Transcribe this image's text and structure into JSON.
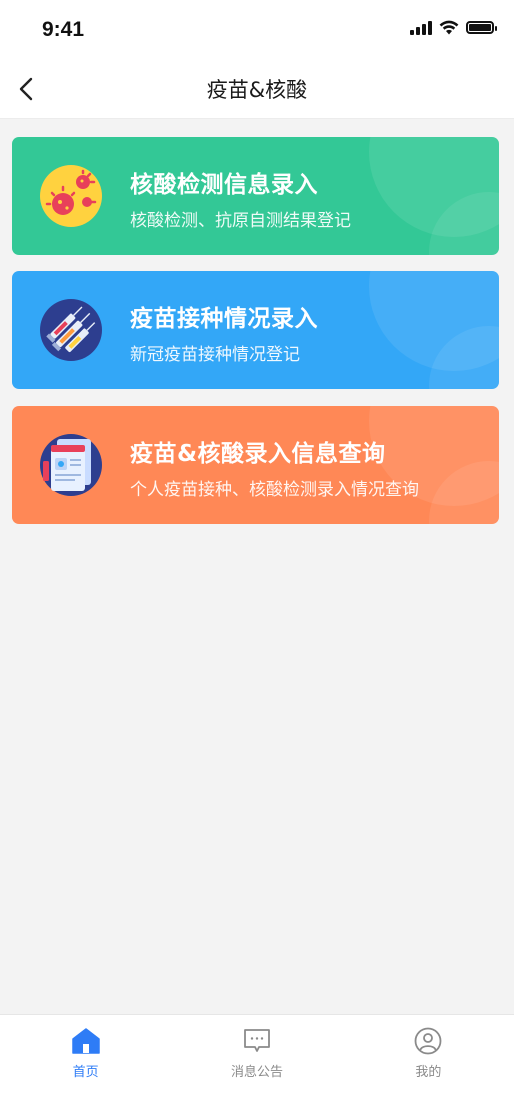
{
  "status_bar": {
    "time": "9:41"
  },
  "nav": {
    "title": "疫苗&核酸"
  },
  "cards": [
    {
      "title": "核酸检测信息录入",
      "subtitle": "核酸检测、抗原自测结果登记",
      "icon": "virus-icon",
      "color": "#33c896"
    },
    {
      "title": "疫苗接种情况录入",
      "subtitle": "新冠疫苗接种情况登记",
      "icon": "syringe-icon",
      "color": "#33a7f7"
    },
    {
      "title": "疫苗&核酸录入信息查询",
      "subtitle": "个人疫苗接种、核酸检测录入情况查询",
      "icon": "document-icon",
      "color": "#ff8856"
    }
  ],
  "tabbar": {
    "items": [
      {
        "label": "首页",
        "icon": "home-icon",
        "active": true
      },
      {
        "label": "消息公告",
        "icon": "message-icon",
        "active": false
      },
      {
        "label": "我的",
        "icon": "user-icon",
        "active": false
      }
    ],
    "active_color": "#2e7cf6"
  }
}
